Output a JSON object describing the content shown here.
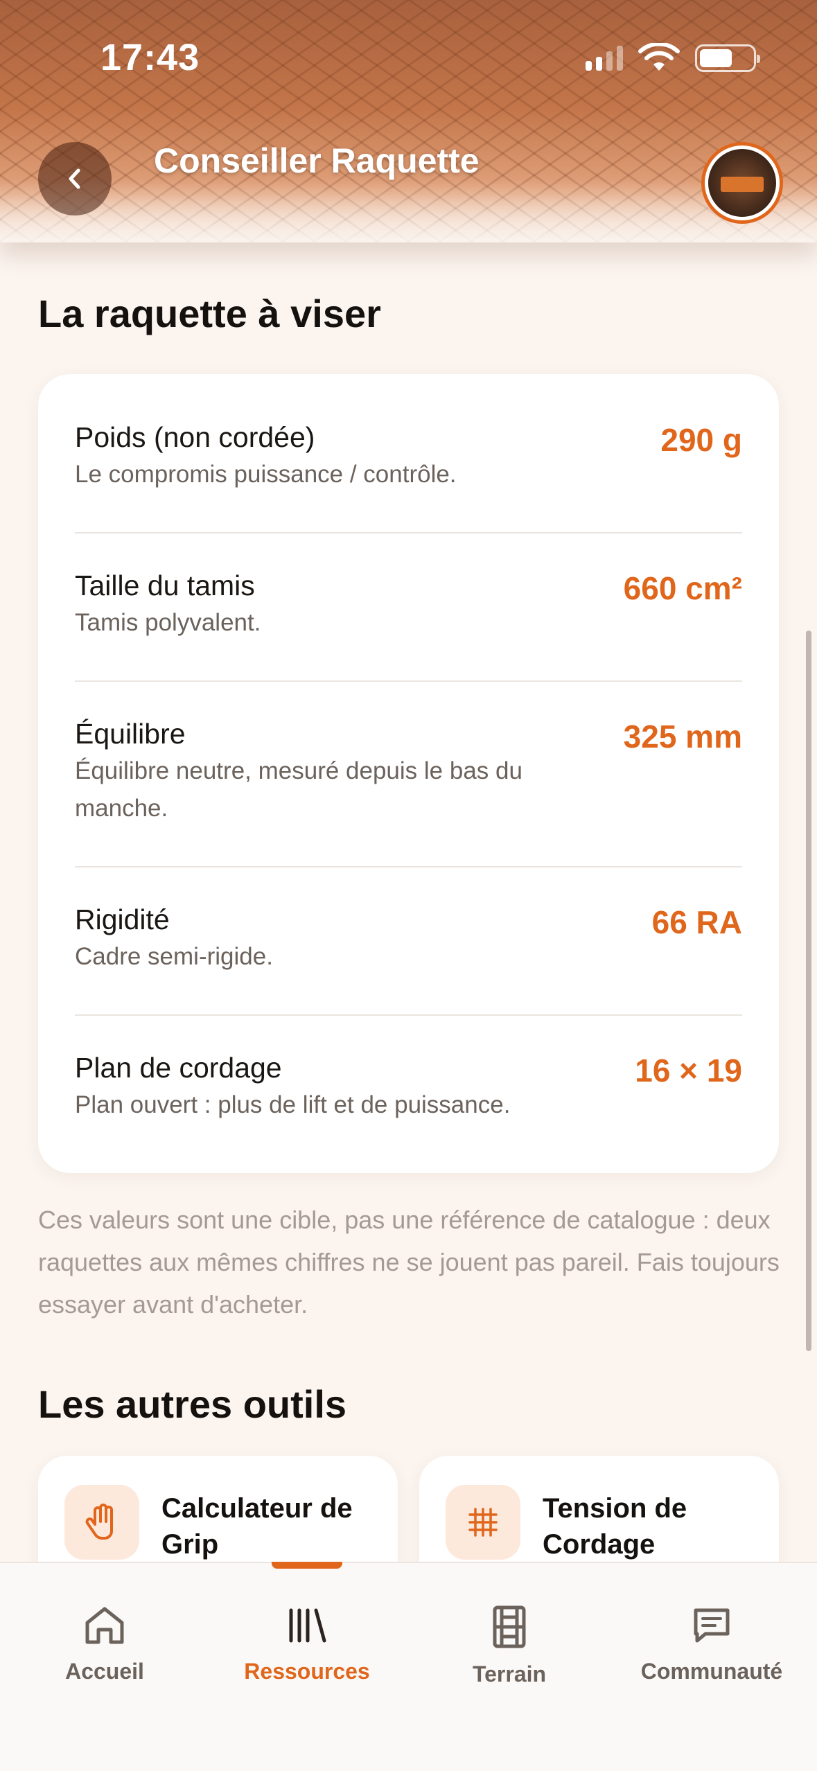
{
  "status_bar": {
    "time": "17:43"
  },
  "header": {
    "title": "Conseiller Raquette"
  },
  "target_section": {
    "title": "La raquette à viser",
    "specs": [
      {
        "label": "Poids (non cordée)",
        "description": "Le compromis puissance / contrôle.",
        "value": "290 g"
      },
      {
        "label": "Taille du tamis",
        "description": "Tamis polyvalent.",
        "value": "660 cm²"
      },
      {
        "label": "Équilibre",
        "description": "Équilibre neutre, mesuré depuis le bas du manche.",
        "value": "325 mm"
      },
      {
        "label": "Rigidité",
        "description": "Cadre semi-rigide.",
        "value": "66 RA"
      },
      {
        "label": "Plan de cordage",
        "description": "Plan ouvert : plus de lift et de puissance.",
        "value": "16 × 19"
      }
    ],
    "note": "Ces valeurs sont une cible, pas une référence de catalogue : deux raquettes aux mêmes chiffres ne se jouent pas pareil. Fais toujours essayer avant d'acheter."
  },
  "other_tools": {
    "title": "Les autres outils",
    "items": [
      {
        "label": "Calculateur de Grip",
        "icon": "hand-icon"
      },
      {
        "label": "Tension de Cordage",
        "icon": "string-grid-icon"
      }
    ]
  },
  "bottom_nav": {
    "items": [
      {
        "label": "Accueil",
        "icon": "home-icon",
        "active": false
      },
      {
        "label": "Ressources",
        "icon": "library-icon",
        "active": true
      },
      {
        "label": "Terrain",
        "icon": "court-icon",
        "active": false
      },
      {
        "label": "Communauté",
        "icon": "chat-icon",
        "active": false
      }
    ]
  },
  "colors": {
    "accent": "#e0661b",
    "background": "#fbf4ef"
  }
}
